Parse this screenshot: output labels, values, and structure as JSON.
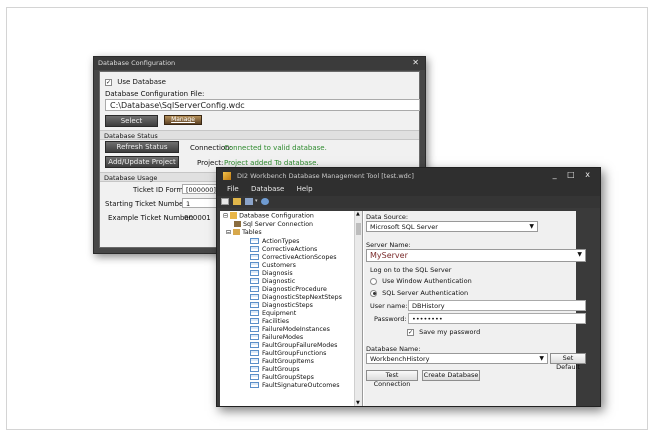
{
  "db_config_dialog": {
    "title": "Database Configuration",
    "use_database_label": "Use Database",
    "use_database_checked": true,
    "config_file_label": "Database Configuration File:",
    "config_file_value": "C:\\Database\\SqlServerConfig.wdc",
    "select_label": "Select",
    "manage_label": "Manage",
    "status_section": "Database Status",
    "refresh_label": "Refresh Status",
    "connection_label": "Connection:",
    "connection_value": "Connected to valid database.",
    "add_update_label": "Add/Update Project",
    "project_label": "Project:",
    "project_value": "Project added To database.",
    "usage_section": "Database Usage",
    "ticket_format_label": "Ticket ID Format:",
    "ticket_format_value": "[000000]",
    "starting_ticket_label": "Starting Ticket Number:",
    "starting_ticket_value": "1",
    "example_ticket_label": "Example Ticket Number:",
    "example_ticket_value": "000001"
  },
  "workbench": {
    "title": "DI2 Workbench Database Management Tool [test.wdc]",
    "window_controls": "_ □ x",
    "menu": [
      "File",
      "Database",
      "Help"
    ],
    "tree_root": "Database Configuration",
    "tree_connection": "Sql Server Connection",
    "tree_tables": "Tables",
    "tables": [
      "ActionTypes",
      "CorrectiveActions",
      "CorrectiveActionScopes",
      "Customers",
      "Diagnosis",
      "Diagnostic",
      "DiagnosticProcedure",
      "DiagnosticStepNextSteps",
      "DiagnosticSteps",
      "Equipment",
      "Facilities",
      "FailureModeInstances",
      "FailureModes",
      "FaultGroupFailureModes",
      "FaultGroupFunctions",
      "FaultGroupItems",
      "FaultGroups",
      "FaultGroupSteps",
      "FaultSignatureOutcomes"
    ],
    "data_source_label": "Data Source:",
    "data_source_value": "Microsoft SQL Server",
    "server_name_label": "Server Name:",
    "server_name_value": "MyServer",
    "logon_label": "Log on to the SQL Server",
    "auth_windows": "Use Window Authentication",
    "auth_sql": "SQL Server Authentication",
    "username_label": "User name:",
    "username_value": "DBHistory",
    "password_label": "Password:",
    "password_value": "••••••••",
    "save_password_label": "Save my password",
    "db_name_label": "Database Name:",
    "db_name_value": "WorkbenchHistory",
    "set_default_label": "Set Default",
    "test_connection_label": "Test Connection",
    "create_database_label": "Create Database"
  },
  "icons": {
    "tree_db": "database-icon",
    "tree_conn": "connection-icon",
    "tree_tables": "tables-icon",
    "table": "table-icon"
  }
}
